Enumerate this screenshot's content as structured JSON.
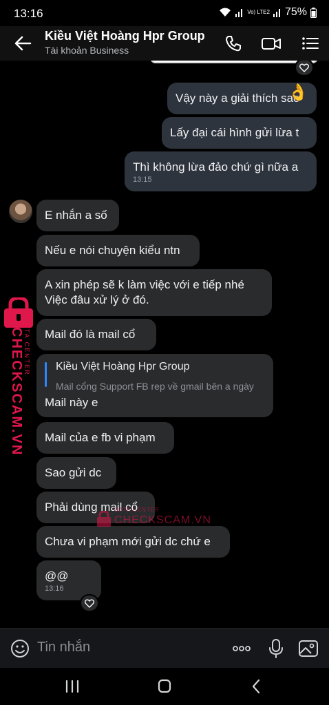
{
  "status": {
    "time": "13:16",
    "battery": "75%",
    "network": "Vo) LTE2"
  },
  "header": {
    "name": "Kiều Việt Hoàng Hpr Group",
    "subtitle": "Tài khoản Business"
  },
  "messages": {
    "m1": {
      "text": "Vậy này a giải thích sao"
    },
    "m2": {
      "text": "Lấy đại cái hình gửi lừa t"
    },
    "m3": {
      "text": "Thì không lừa đảo chứ gì nữa a",
      "time": "13:15"
    },
    "m4": {
      "text": "E nhắn a số"
    },
    "m5": {
      "text": "Nếu e nói chuyện kiểu ntn"
    },
    "m6": {
      "line1": "A xin phép sẽ k làm việc với e tiếp nhé",
      "line2": "Việc đâu xử lý ở đó."
    },
    "m7": {
      "text": "Mail đó là mail cổ"
    },
    "m8": {
      "reply_name": "Kiều Việt Hoàng Hpr Group",
      "reply_text": "Mail cổng Support FB  rep về gmail bên a ngày",
      "text": "Mail này e"
    },
    "m9": {
      "text": "Mail của e fb vi phạm"
    },
    "m10": {
      "text": "Sao gửi dc"
    },
    "m11": {
      "text": "Phải dùng mail cổ"
    },
    "m12": {
      "text": "Chưa vi phạm mới gửi dc chứ e"
    },
    "m13": {
      "text": "@@",
      "time": "13:16"
    }
  },
  "reaction_emoji": "👌",
  "composer": {
    "placeholder": "Tin nhắn"
  },
  "watermark": {
    "brand": "CHECKSCAM.VN",
    "tag": "DATA CENTER"
  },
  "colors": {
    "accent": "#2d88ff",
    "watermark": "#e0174b",
    "bubble_out": "#2e343d",
    "bubble_in": "#2a2b2d"
  }
}
